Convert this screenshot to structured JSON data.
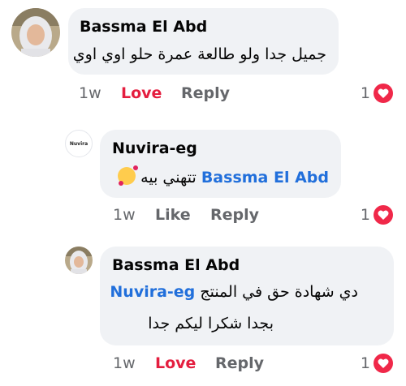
{
  "comments": [
    {
      "author": "Bassma El Abd",
      "lines": [
        "جميل جدا ولو طالعة عمرة حلو اوي اوي"
      ],
      "time": "1w",
      "action_1": "Love",
      "action_2": "Reply",
      "reaction_count": "1",
      "reaction_icon": "heart-icon"
    },
    {
      "author": "Nuvira-eg",
      "avatar_logo": "Nuvira",
      "mention": "Bassma El Abd",
      "line_text": "تتهني بيه",
      "emoji": "smiling-face-with-hearts",
      "time": "1w",
      "action_1": "Like",
      "action_2": "Reply",
      "reaction_count": "1",
      "reaction_icon": "heart-icon"
    },
    {
      "author": "Bassma El Abd",
      "line1_text": "دي شهادة حق في المنتج",
      "mention": "Nuvira-eg",
      "line2": "بجدا شكرا ليكم جدا",
      "time": "1w",
      "action_1": "Love",
      "action_2": "Reply",
      "reaction_count": "1",
      "reaction_icon": "heart-icon"
    }
  ],
  "colors": {
    "bubble": "#f0f2f5",
    "mention": "#216fdb",
    "love": "#e41e3f",
    "muted": "#65676b",
    "heart_badge": "#f02849"
  }
}
